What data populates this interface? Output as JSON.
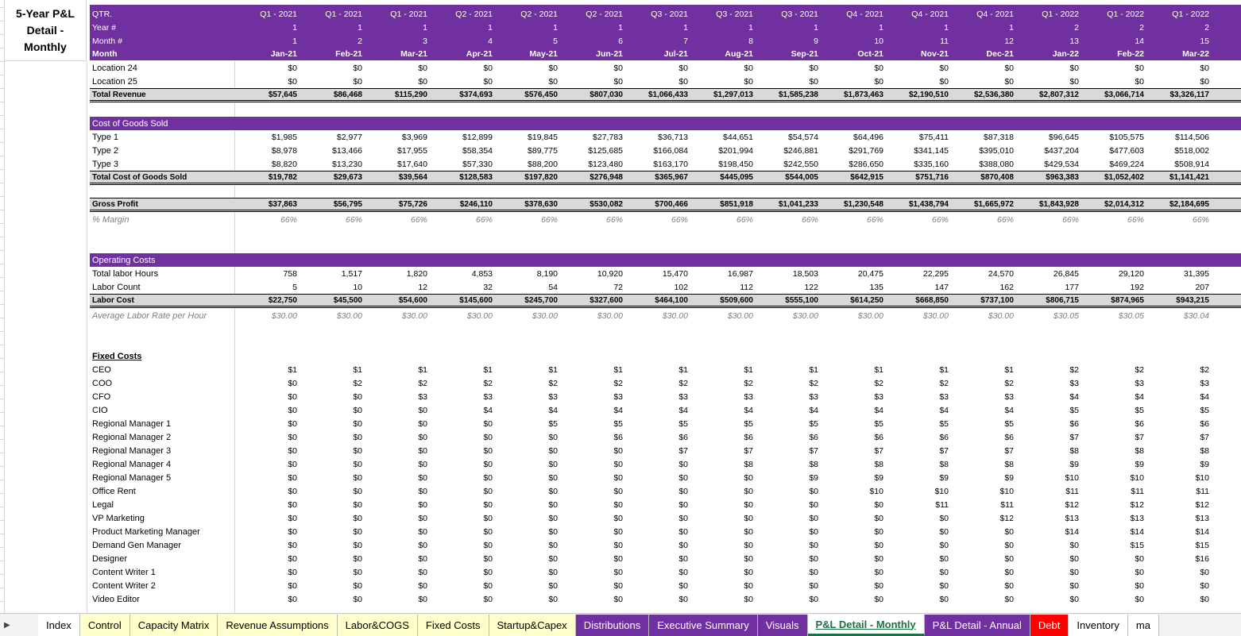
{
  "title": "5-Year P&L Detail - Monthly",
  "header_rows": [
    {
      "label": "QTR.",
      "values": [
        "Q1 - 2021",
        "Q1 - 2021",
        "Q1 - 2021",
        "Q2 - 2021",
        "Q2 - 2021",
        "Q2 - 2021",
        "Q3 - 2021",
        "Q3 - 2021",
        "Q3 - 2021",
        "Q4 - 2021",
        "Q4 - 2021",
        "Q4 - 2021",
        "Q1 - 2022",
        "Q1 - 2022",
        "Q1 - 2022"
      ]
    },
    {
      "label": "Year #",
      "values": [
        "1",
        "1",
        "1",
        "1",
        "1",
        "1",
        "1",
        "1",
        "1",
        "1",
        "1",
        "1",
        "2",
        "2",
        "2"
      ]
    },
    {
      "label": "Month #",
      "values": [
        "1",
        "2",
        "3",
        "4",
        "5",
        "6",
        "7",
        "8",
        "9",
        "10",
        "11",
        "12",
        "13",
        "14",
        "15"
      ]
    },
    {
      "label": "Month",
      "values": [
        "Jan-21",
        "Feb-21",
        "Mar-21",
        "Apr-21",
        "May-21",
        "Jun-21",
        "Jul-21",
        "Aug-21",
        "Sep-21",
        "Oct-21",
        "Nov-21",
        "Dec-21",
        "Jan-22",
        "Feb-22",
        "Mar-22"
      ]
    }
  ],
  "revenue_rows": [
    {
      "label": "Location 24",
      "values": [
        "$0",
        "$0",
        "$0",
        "$0",
        "$0",
        "$0",
        "$0",
        "$0",
        "$0",
        "$0",
        "$0",
        "$0",
        "$0",
        "$0",
        "$0"
      ]
    },
    {
      "label": "Location 25",
      "values": [
        "$0",
        "$0",
        "$0",
        "$0",
        "$0",
        "$0",
        "$0",
        "$0",
        "$0",
        "$0",
        "$0",
        "$0",
        "$0",
        "$0",
        "$0"
      ]
    }
  ],
  "total_revenue": {
    "label": "Total Revenue",
    "values": [
      "$57,645",
      "$86,468",
      "$115,290",
      "$374,693",
      "$576,450",
      "$807,030",
      "$1,066,433",
      "$1,297,013",
      "$1,585,238",
      "$1,873,463",
      "$2,190,510",
      "$2,536,380",
      "$2,807,312",
      "$3,066,714",
      "$3,326,117"
    ]
  },
  "cogs_header": "Cost of Goods Sold",
  "cogs_rows": [
    {
      "label": "Type 1",
      "values": [
        "$1,985",
        "$2,977",
        "$3,969",
        "$12,899",
        "$19,845",
        "$27,783",
        "$36,713",
        "$44,651",
        "$54,574",
        "$64,496",
        "$75,411",
        "$87,318",
        "$96,645",
        "$105,575",
        "$114,506"
      ]
    },
    {
      "label": "Type 2",
      "values": [
        "$8,978",
        "$13,466",
        "$17,955",
        "$58,354",
        "$89,775",
        "$125,685",
        "$166,084",
        "$201,994",
        "$246,881",
        "$291,769",
        "$341,145",
        "$395,010",
        "$437,204",
        "$477,603",
        "$518,002"
      ]
    },
    {
      "label": "Type 3",
      "values": [
        "$8,820",
        "$13,230",
        "$17,640",
        "$57,330",
        "$88,200",
        "$123,480",
        "$163,170",
        "$198,450",
        "$242,550",
        "$286,650",
        "$335,160",
        "$388,080",
        "$429,534",
        "$469,224",
        "$508,914"
      ]
    }
  ],
  "total_cogs": {
    "label": "Total Cost of Goods Sold",
    "values": [
      "$19,782",
      "$29,673",
      "$39,564",
      "$128,583",
      "$197,820",
      "$276,948",
      "$365,967",
      "$445,095",
      "$544,005",
      "$642,915",
      "$751,716",
      "$870,408",
      "$963,383",
      "$1,052,402",
      "$1,141,421"
    ]
  },
  "gross_profit": {
    "label": "Gross Profit",
    "values": [
      "$37,863",
      "$56,795",
      "$75,726",
      "$246,110",
      "$378,630",
      "$530,082",
      "$700,466",
      "$851,918",
      "$1,041,233",
      "$1,230,548",
      "$1,438,794",
      "$1,665,972",
      "$1,843,928",
      "$2,014,312",
      "$2,184,695"
    ]
  },
  "margin": {
    "label": "% Margin",
    "values": [
      "66%",
      "66%",
      "66%",
      "66%",
      "66%",
      "66%",
      "66%",
      "66%",
      "66%",
      "66%",
      "66%",
      "66%",
      "66%",
      "66%",
      "66%"
    ]
  },
  "opex_header": "Operating Costs",
  "labor_rows": [
    {
      "label": "Total labor Hours",
      "values": [
        "758",
        "1,517",
        "1,820",
        "4,853",
        "8,190",
        "10,920",
        "15,470",
        "16,987",
        "18,503",
        "20,475",
        "22,295",
        "24,570",
        "26,845",
        "29,120",
        "31,395"
      ]
    },
    {
      "label": "Labor Count",
      "values": [
        "5",
        "10",
        "12",
        "32",
        "54",
        "72",
        "102",
        "112",
        "122",
        "135",
        "147",
        "162",
        "177",
        "192",
        "207"
      ]
    }
  ],
  "labor_cost": {
    "label": "Labor Cost",
    "values": [
      "$22,750",
      "$45,500",
      "$54,600",
      "$145,600",
      "$245,700",
      "$327,600",
      "$464,100",
      "$509,600",
      "$555,100",
      "$614,250",
      "$668,850",
      "$737,100",
      "$806,715",
      "$874,965",
      "$943,215"
    ]
  },
  "avg_rate": {
    "label": "Average Labor Rate per Hour",
    "values": [
      "$30.00",
      "$30.00",
      "$30.00",
      "$30.00",
      "$30.00",
      "$30.00",
      "$30.00",
      "$30.00",
      "$30.00",
      "$30.00",
      "$30.00",
      "$30.00",
      "$30.05",
      "$30.05",
      "$30.04"
    ]
  },
  "fixed_header": "Fixed Costs",
  "fixed_rows": [
    {
      "label": "CEO",
      "values": [
        "$1",
        "$1",
        "$1",
        "$1",
        "$1",
        "$1",
        "$1",
        "$1",
        "$1",
        "$1",
        "$1",
        "$1",
        "$2",
        "$2",
        "$2"
      ]
    },
    {
      "label": "COO",
      "values": [
        "$0",
        "$2",
        "$2",
        "$2",
        "$2",
        "$2",
        "$2",
        "$2",
        "$2",
        "$2",
        "$2",
        "$2",
        "$3",
        "$3",
        "$3"
      ]
    },
    {
      "label": "CFO",
      "values": [
        "$0",
        "$0",
        "$3",
        "$3",
        "$3",
        "$3",
        "$3",
        "$3",
        "$3",
        "$3",
        "$3",
        "$3",
        "$4",
        "$4",
        "$4"
      ]
    },
    {
      "label": "CIO",
      "values": [
        "$0",
        "$0",
        "$0",
        "$4",
        "$4",
        "$4",
        "$4",
        "$4",
        "$4",
        "$4",
        "$4",
        "$4",
        "$5",
        "$5",
        "$5"
      ]
    },
    {
      "label": "Regional Manager 1",
      "values": [
        "$0",
        "$0",
        "$0",
        "$0",
        "$5",
        "$5",
        "$5",
        "$5",
        "$5",
        "$5",
        "$5",
        "$5",
        "$6",
        "$6",
        "$6"
      ]
    },
    {
      "label": "Regional Manager 2",
      "values": [
        "$0",
        "$0",
        "$0",
        "$0",
        "$0",
        "$6",
        "$6",
        "$6",
        "$6",
        "$6",
        "$6",
        "$6",
        "$7",
        "$7",
        "$7"
      ]
    },
    {
      "label": "Regional Manager 3",
      "values": [
        "$0",
        "$0",
        "$0",
        "$0",
        "$0",
        "$0",
        "$7",
        "$7",
        "$7",
        "$7",
        "$7",
        "$7",
        "$8",
        "$8",
        "$8"
      ]
    },
    {
      "label": "Regional Manager 4",
      "values": [
        "$0",
        "$0",
        "$0",
        "$0",
        "$0",
        "$0",
        "$0",
        "$8",
        "$8",
        "$8",
        "$8",
        "$8",
        "$9",
        "$9",
        "$9"
      ]
    },
    {
      "label": "Regional Manager 5",
      "values": [
        "$0",
        "$0",
        "$0",
        "$0",
        "$0",
        "$0",
        "$0",
        "$0",
        "$9",
        "$9",
        "$9",
        "$9",
        "$10",
        "$10",
        "$10"
      ]
    },
    {
      "label": "Office Rent",
      "values": [
        "$0",
        "$0",
        "$0",
        "$0",
        "$0",
        "$0",
        "$0",
        "$0",
        "$0",
        "$10",
        "$10",
        "$10",
        "$11",
        "$11",
        "$11"
      ]
    },
    {
      "label": "Legal",
      "values": [
        "$0",
        "$0",
        "$0",
        "$0",
        "$0",
        "$0",
        "$0",
        "$0",
        "$0",
        "$0",
        "$11",
        "$11",
        "$12",
        "$12",
        "$12"
      ]
    },
    {
      "label": "VP Marketing",
      "values": [
        "$0",
        "$0",
        "$0",
        "$0",
        "$0",
        "$0",
        "$0",
        "$0",
        "$0",
        "$0",
        "$0",
        "$12",
        "$13",
        "$13",
        "$13"
      ]
    },
    {
      "label": "Product Marketing Manager",
      "values": [
        "$0",
        "$0",
        "$0",
        "$0",
        "$0",
        "$0",
        "$0",
        "$0",
        "$0",
        "$0",
        "$0",
        "$0",
        "$14",
        "$14",
        "$14"
      ]
    },
    {
      "label": "Demand Gen Manager",
      "values": [
        "$0",
        "$0",
        "$0",
        "$0",
        "$0",
        "$0",
        "$0",
        "$0",
        "$0",
        "$0",
        "$0",
        "$0",
        "$0",
        "$15",
        "$15"
      ]
    },
    {
      "label": "Designer",
      "values": [
        "$0",
        "$0",
        "$0",
        "$0",
        "$0",
        "$0",
        "$0",
        "$0",
        "$0",
        "$0",
        "$0",
        "$0",
        "$0",
        "$0",
        "$16"
      ]
    },
    {
      "label": "Content Writer 1",
      "values": [
        "$0",
        "$0",
        "$0",
        "$0",
        "$0",
        "$0",
        "$0",
        "$0",
        "$0",
        "$0",
        "$0",
        "$0",
        "$0",
        "$0",
        "$0"
      ]
    },
    {
      "label": "Content Writer 2",
      "values": [
        "$0",
        "$0",
        "$0",
        "$0",
        "$0",
        "$0",
        "$0",
        "$0",
        "$0",
        "$0",
        "$0",
        "$0",
        "$0",
        "$0",
        "$0"
      ]
    },
    {
      "label": "Video Editor",
      "values": [
        "$0",
        "$0",
        "$0",
        "$0",
        "$0",
        "$0",
        "$0",
        "$0",
        "$0",
        "$0",
        "$0",
        "$0",
        "$0",
        "$0",
        "$0"
      ]
    }
  ],
  "tabs": [
    {
      "label": "Index",
      "bg": "#ffffff",
      "color": "#000000",
      "active": false
    },
    {
      "label": "Control",
      "bg": "#ffffcc",
      "color": "#000000",
      "active": false
    },
    {
      "label": "Capacity Matrix",
      "bg": "#ffffcc",
      "color": "#000000",
      "active": false
    },
    {
      "label": "Revenue Assumptions",
      "bg": "#ffffcc",
      "color": "#000000",
      "active": false
    },
    {
      "label": "Labor&COGS",
      "bg": "#ffffcc",
      "color": "#000000",
      "active": false
    },
    {
      "label": "Fixed Costs",
      "bg": "#ffffcc",
      "color": "#000000",
      "active": false
    },
    {
      "label": "Startup&Capex",
      "bg": "#ffffcc",
      "color": "#000000",
      "active": false
    },
    {
      "label": "Distributions",
      "bg": "#7030a0",
      "color": "#ffffff",
      "active": false
    },
    {
      "label": "Executive Summary",
      "bg": "#7030a0",
      "color": "#ffffff",
      "active": false
    },
    {
      "label": "Visuals",
      "bg": "#7030a0",
      "color": "#ffffff",
      "active": false
    },
    {
      "label": "P&L Detail - Monthly",
      "bg": "#ffffff",
      "color": "#1e7145",
      "active": true
    },
    {
      "label": "P&L Detail - Annual",
      "bg": "#7030a0",
      "color": "#ffffff",
      "active": false
    },
    {
      "label": "Debt",
      "bg": "#ff0000",
      "color": "#ffffff",
      "active": false
    },
    {
      "label": "Inventory",
      "bg": "#ffffff",
      "color": "#000000",
      "active": false
    },
    {
      "label": "ma",
      "bg": "#ffffff",
      "color": "#000000",
      "active": false
    }
  ],
  "colors": {
    "accent": "#7030a0",
    "total_bg": "#d9d9d9",
    "active_tab": "#1e7145"
  }
}
